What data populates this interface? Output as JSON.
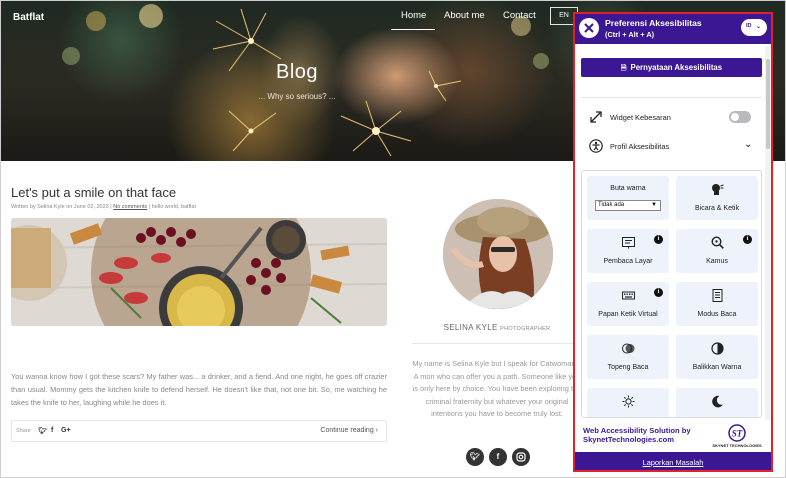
{
  "navbar": {
    "brand": "Batflat",
    "items": [
      "Home",
      "About me",
      "Contact"
    ],
    "active": "Home",
    "language": "EN"
  },
  "hero": {
    "title": "Blog",
    "subtitle": "... Why so serious? ..."
  },
  "post": {
    "title": "Let's put a smile on that face",
    "meta_prefix": "Written by Selina Kyle on June 02, 2023 |",
    "meta_comments": "No comments",
    "meta_tags": "| hello world, batflat",
    "body": "You wanna know how I got these scars? My father was... a drinker, and a fiend. And one night, he goes off crazier than usual. Mommy gets the kitchen knife to defend herself. He doesn't like that, not one bit. So, me watching he takes the knife to her, laughing while he does it.",
    "share_label": "Share",
    "share_icons": [
      "twitter-icon",
      "facebook-icon",
      "google-plus-icon"
    ],
    "continue_label": "Continue reading ›"
  },
  "profile": {
    "name": "SELINA KYLE",
    "role": "PHOTOGRAPHER",
    "bio": "My name is Selina Kyle but I speak for Catwoman... A mon who can offer you a path. Someone like you is only here by choice. You have been exploring the criminal fraternity but whatever your original intentions you have to become truly lost.",
    "social": [
      "twitter",
      "facebook",
      "instagram"
    ]
  },
  "accessibility": {
    "title": "Preferensi Aksesibilitas",
    "shortcut": "(Ctrl + Alt + A)",
    "language": "ID",
    "statement_button": "Pernyataan Aksesibilitas",
    "widget_size_label": "Widget Kebesaran",
    "widget_size_enabled": false,
    "profiles_label": "Profil Aksesibilitas",
    "color_blind": {
      "label": "Buta warna",
      "selected": "Tidak ada"
    },
    "tiles": [
      {
        "label": "Bicara & Ketik",
        "icon": "speak-type-icon",
        "info": false
      },
      {
        "label": "Pembaca Layar",
        "icon": "screen-reader-icon",
        "info": true
      },
      {
        "label": "Kamus",
        "icon": "dictionary-icon",
        "info": true
      },
      {
        "label": "Papan Ketik Virtual",
        "icon": "keyboard-icon",
        "info": true
      },
      {
        "label": "Modus Baca",
        "icon": "read-mode-icon",
        "info": false
      },
      {
        "label": "Topeng Baca",
        "icon": "reading-mask-icon",
        "info": false
      },
      {
        "label": "Balikkan Warna",
        "icon": "invert-colors-icon",
        "info": false
      },
      {
        "label": "",
        "icon": "brightness-icon",
        "info": false
      },
      {
        "label": "",
        "icon": "dark-mode-icon",
        "info": false
      }
    ],
    "footer_brand": "Web Accessibility Solution by SkynetTechnologies.com",
    "footer_brand_line1": "Web Accessibility Solution by",
    "footer_brand_line2": "SkynetTechnologies.com",
    "logo_name": "SKYNET TECHNOLOGIES",
    "report_link": "Laporkan Masalah",
    "colors": {
      "primary": "#3b1794",
      "highlight_border": "#e0212a",
      "tile_bg": "#eef2fb"
    }
  }
}
